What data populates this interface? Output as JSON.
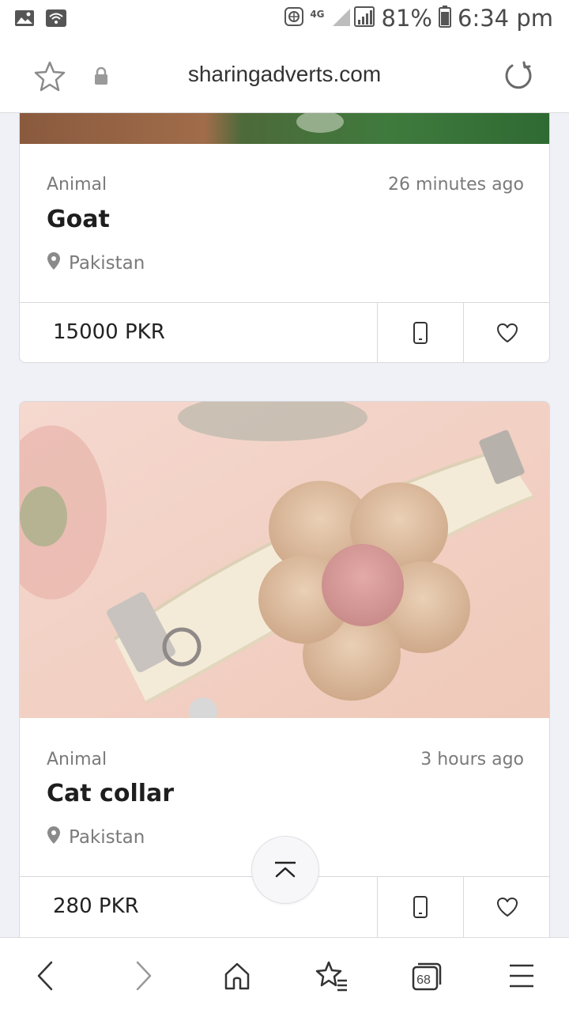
{
  "status_bar": {
    "network": "4G",
    "battery": "81%",
    "time": "6:34 pm"
  },
  "browser": {
    "url": "sharingadverts.com"
  },
  "listings": [
    {
      "category": "Animal",
      "time_ago": "26 minutes ago",
      "title": "Goat",
      "location": "Pakistan",
      "price": "15000 PKR"
    },
    {
      "category": "Animal",
      "time_ago": "3 hours ago",
      "title": "Cat collar",
      "location": "Pakistan",
      "price": "280 PKR"
    }
  ],
  "bottom_nav": {
    "tabs_count": "68"
  },
  "colors": {
    "page_background": "#f0f1f6",
    "icon_gray": "#5a5a5a",
    "text_muted": "#7a7a7a"
  }
}
